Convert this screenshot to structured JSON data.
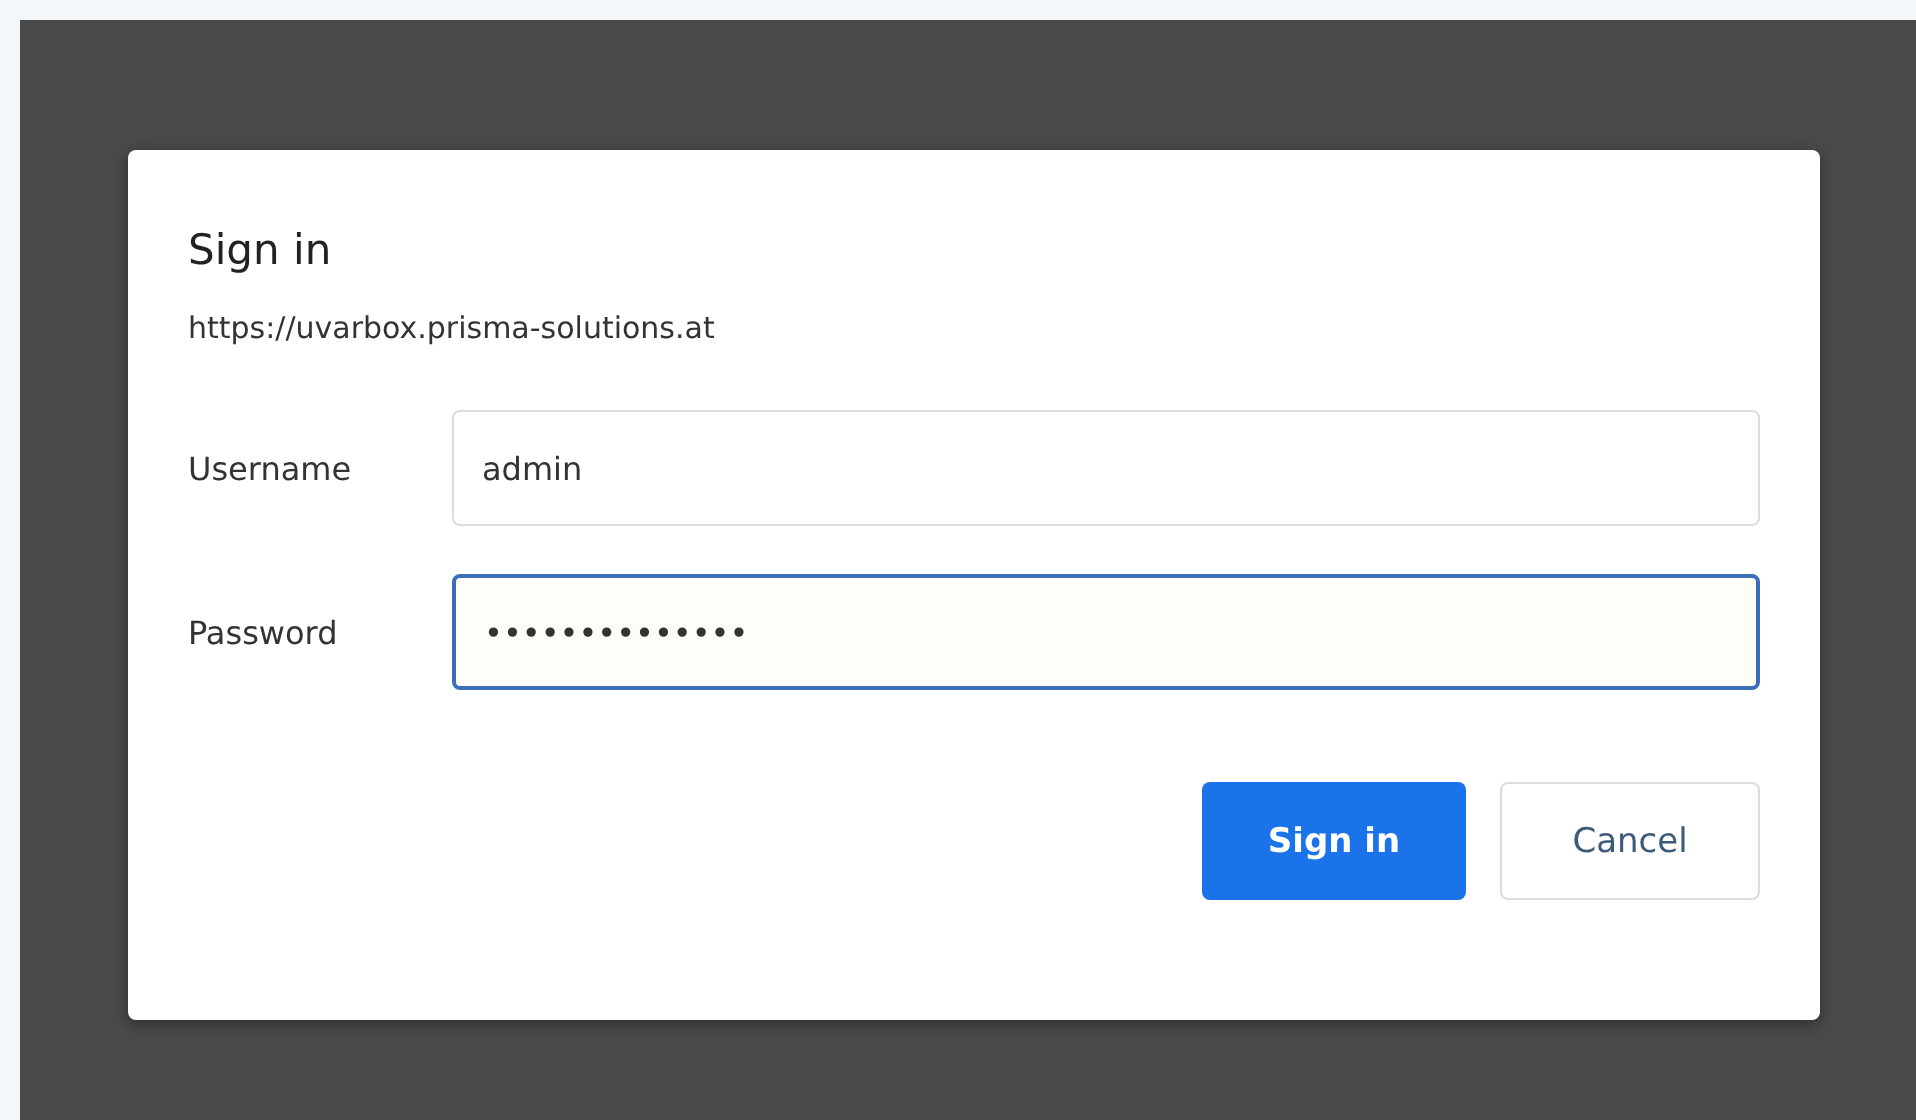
{
  "dialog": {
    "title": "Sign in",
    "url": "https://uvarbox.prisma-solutions.at",
    "fields": [
      {
        "label": "Username",
        "value": "admin",
        "focused": false
      },
      {
        "label": "Password",
        "value": "••••••••••••••",
        "focused": true
      }
    ],
    "buttons": [
      {
        "label": "Sign in",
        "kind": "primary"
      },
      {
        "label": "Cancel",
        "kind": "secondary"
      }
    ]
  }
}
